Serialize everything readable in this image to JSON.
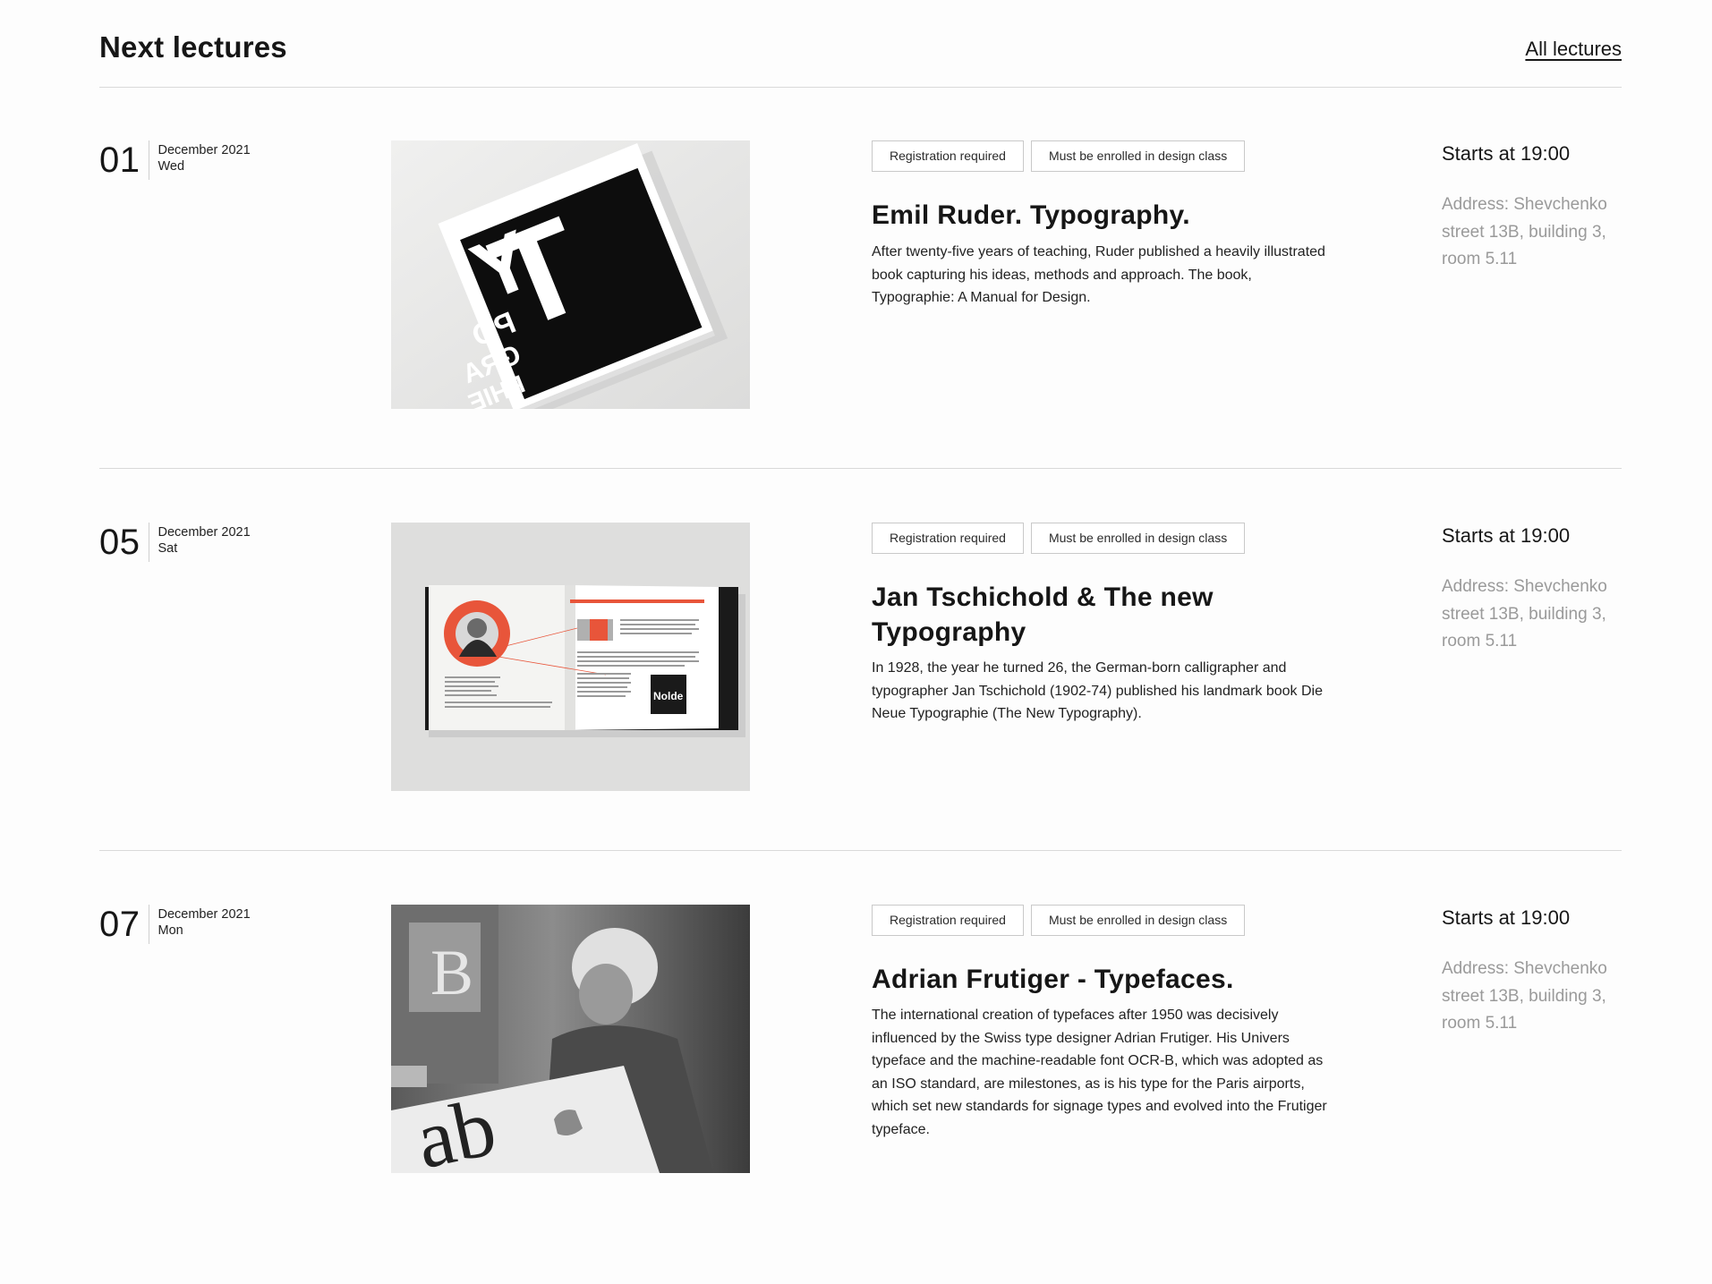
{
  "header": {
    "title": "Next lectures",
    "all_link": "All lectures"
  },
  "lectures": [
    {
      "day": "01",
      "month": "December 2021",
      "weekday": "Wed",
      "tags": [
        "Registration required",
        "Must be enrolled in design class"
      ],
      "title": "Emil Ruder. Typography.",
      "description": "After twenty-five years of teaching, Ruder published a heavily illustrated book capturing his ideas, methods and approach. The book, Typographie: A Manual for Design.",
      "starts": "Starts at 19:00",
      "address": "Address: Shevchenko street 13B, building 3, room 5.11",
      "image_letters": [
        "T",
        "Y",
        "PO",
        "GRA",
        "PHIE"
      ]
    },
    {
      "day": "05",
      "month": "December 2021",
      "weekday": "Sat",
      "tags": [
        "Registration required",
        "Must be enrolled in design class"
      ],
      "title": "Jan Tschichold & The new Typography",
      "description": "In 1928, the year he turned 26, the German-born calligrapher and typographer Jan Tschichold (1902-74) published his landmark book Die Neue Typographie (The New Typography).",
      "starts": "Starts at 19:00",
      "address": "Address: Shevchenko street 13B, building 3, room 5.11",
      "image_letters": [
        "Nolde"
      ]
    },
    {
      "day": "07",
      "month": "December 2021",
      "weekday": "Mon",
      "tags": [
        "Registration required",
        "Must be enrolled in design class"
      ],
      "title": "Adrian Frutiger - Typefaces.",
      "description": "The international creation of typefaces after 1950 was decisively influenced by the Swiss type designer Adrian Frutiger. His Univers typeface and the machine-readable font OCR-B, which was adopted as an ISO standard, are milestones, as is his type for the Paris airports, which set new standards for signage types and evolved into the Frutiger typeface.",
      "starts": "Starts at 19:00",
      "address": "Address: Shevchenko street 13B, building 3, room 5.11",
      "image_letters": [
        "B",
        "ab"
      ]
    }
  ],
  "colors": {
    "accent": "#e8553a",
    "text": "#161616",
    "muted": "#9a9a9a",
    "divider": "#d9d9d9"
  }
}
